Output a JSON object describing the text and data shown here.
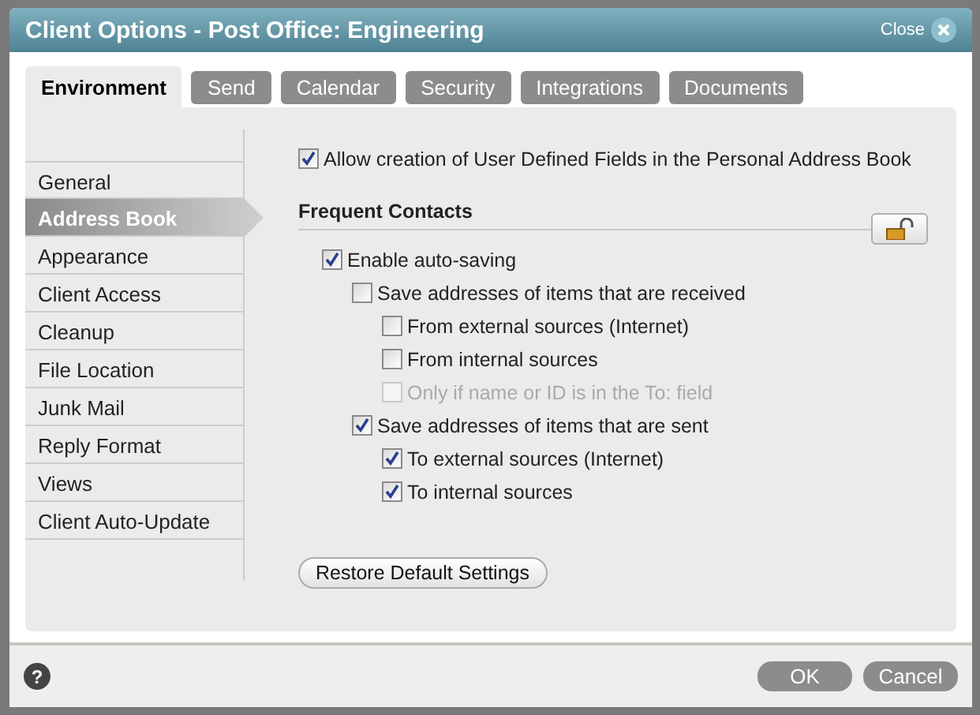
{
  "window": {
    "title": "Client Options - Post Office: Engineering",
    "close_label": "Close"
  },
  "tabs": [
    {
      "label": "Environment",
      "selected": true
    },
    {
      "label": "Send",
      "selected": false
    },
    {
      "label": "Calendar",
      "selected": false
    },
    {
      "label": "Security",
      "selected": false
    },
    {
      "label": "Integrations",
      "selected": false
    },
    {
      "label": "Documents",
      "selected": false
    }
  ],
  "sidebar": {
    "items": [
      {
        "label": "General",
        "selected": false
      },
      {
        "label": "Address Book",
        "selected": true
      },
      {
        "label": "Appearance",
        "selected": false
      },
      {
        "label": "Client Access",
        "selected": false
      },
      {
        "label": "Cleanup",
        "selected": false
      },
      {
        "label": "File Location",
        "selected": false
      },
      {
        "label": "Junk Mail",
        "selected": false
      },
      {
        "label": "Reply Format",
        "selected": false
      },
      {
        "label": "Views",
        "selected": false
      },
      {
        "label": "Client Auto-Update",
        "selected": false
      }
    ]
  },
  "allow_udf": {
    "label": "Allow creation of User Defined Fields in the Personal Address Book",
    "checked": true,
    "disabled": false
  },
  "section": {
    "title": "Frequent Contacts",
    "locked": false
  },
  "options": [
    {
      "label": "Enable auto-saving",
      "checked": true,
      "disabled": false,
      "children": [
        {
          "label": "Save addresses of items that are received",
          "checked": false,
          "disabled": false,
          "children": [
            {
              "label": "From external sources (Internet)",
              "checked": false,
              "disabled": false
            },
            {
              "label": "From internal sources",
              "checked": false,
              "disabled": false
            },
            {
              "label": "Only if name or ID is in the To: field",
              "checked": false,
              "disabled": true
            }
          ]
        },
        {
          "label": "Save addresses of items that are sent",
          "checked": true,
          "disabled": false,
          "children": [
            {
              "label": "To external sources (Internet)",
              "checked": true,
              "disabled": false
            },
            {
              "label": "To internal sources",
              "checked": true,
              "disabled": false
            }
          ]
        }
      ]
    }
  ],
  "restore_button": "Restore Default Settings",
  "help": "?",
  "buttons": [
    "OK",
    "Cancel"
  ]
}
